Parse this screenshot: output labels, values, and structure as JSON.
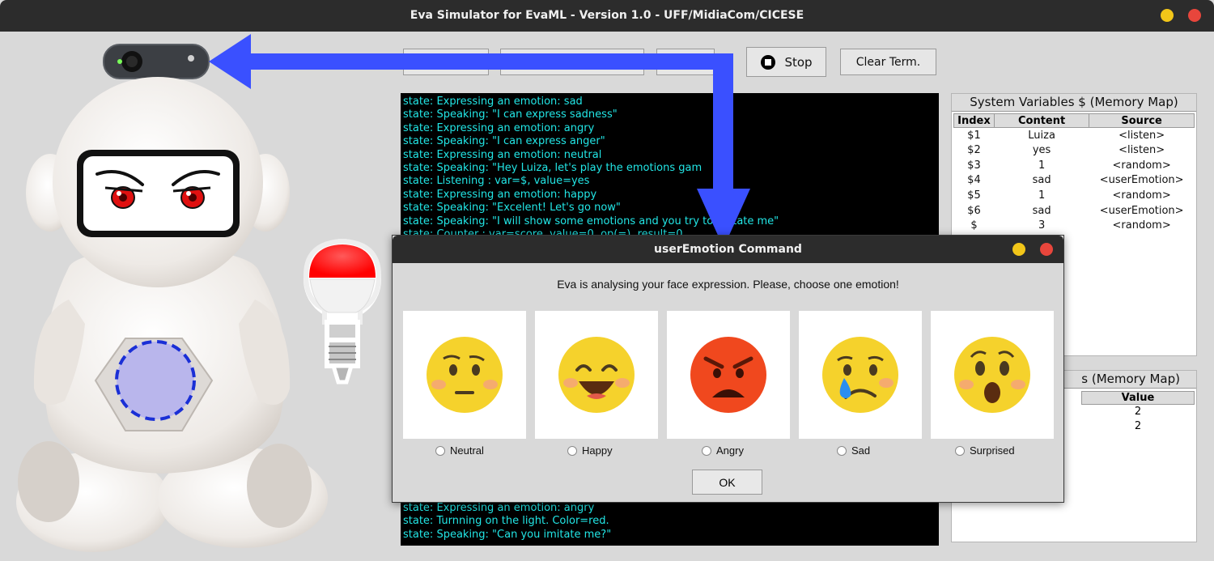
{
  "window": {
    "title": "Eva Simulator for EvaML - Version 1.0 - UFF/MidiaCom/CICESE"
  },
  "toolbar": {
    "stop_label": "Stop",
    "clear_label": "Clear Term."
  },
  "terminal": {
    "top_lines": [
      "state: Expressing an emotion: sad",
      "state: Speaking: \"I can express sadness\"",
      "state: Expressing an emotion: angry",
      "state: Speaking: \"I can express anger\"",
      "state: Expressing an emotion: neutral",
      "state: Speaking: \"Hey Luiza, let's play the emotions gam",
      "state: Listening : var=$, value=yes",
      "state: Expressing an emotion: happy",
      "state: Speaking: \"Excelent! Let's go now\"",
      "state: Speaking: \"I will show some emotions and you try to imitate me\"",
      "state: Counter : var=score, value=0, op(=), result=0"
    ],
    "bottom_lines": [
      "state: Expressing an emotion: angry",
      "state: Turnning on the light. Color=red.",
      "state: Speaking: \"Can you imitate me?\""
    ]
  },
  "system_vars": {
    "title": "System Variables $ (Memory Map)",
    "headers": [
      "Index",
      "Content",
      "Source"
    ],
    "rows": [
      [
        "$1",
        "Luiza",
        "<listen>"
      ],
      [
        "$2",
        "yes",
        "<listen>"
      ],
      [
        "$3",
        "1",
        "<random>"
      ],
      [
        "$4",
        "sad",
        "<userEmotion>"
      ],
      [
        "$5",
        "1",
        "<random>"
      ],
      [
        "$6",
        "sad",
        "<userEmotion>"
      ],
      [
        "$",
        "3",
        "<random>"
      ]
    ]
  },
  "user_vars": {
    "title_visible": "s (Memory Map)",
    "value_header": "Value",
    "values": [
      "2",
      "2"
    ]
  },
  "dialog": {
    "title": "userEmotion Command",
    "message": "Eva is analysing your face expression. Please, choose one emotion!",
    "options": [
      "Neutral",
      "Happy",
      "Angry",
      "Sad",
      "Surprised"
    ],
    "ok_label": "OK"
  },
  "robot": {
    "light_color": "#ff1a1a",
    "eye_color": "#e01010",
    "speaker_ring_color": "#1a2fd6"
  },
  "colors": {
    "arrow": "#3a50ff",
    "terminal_text": "#22e6e6",
    "close_button": "#e8463c",
    "minimize_button": "#f2c619"
  }
}
